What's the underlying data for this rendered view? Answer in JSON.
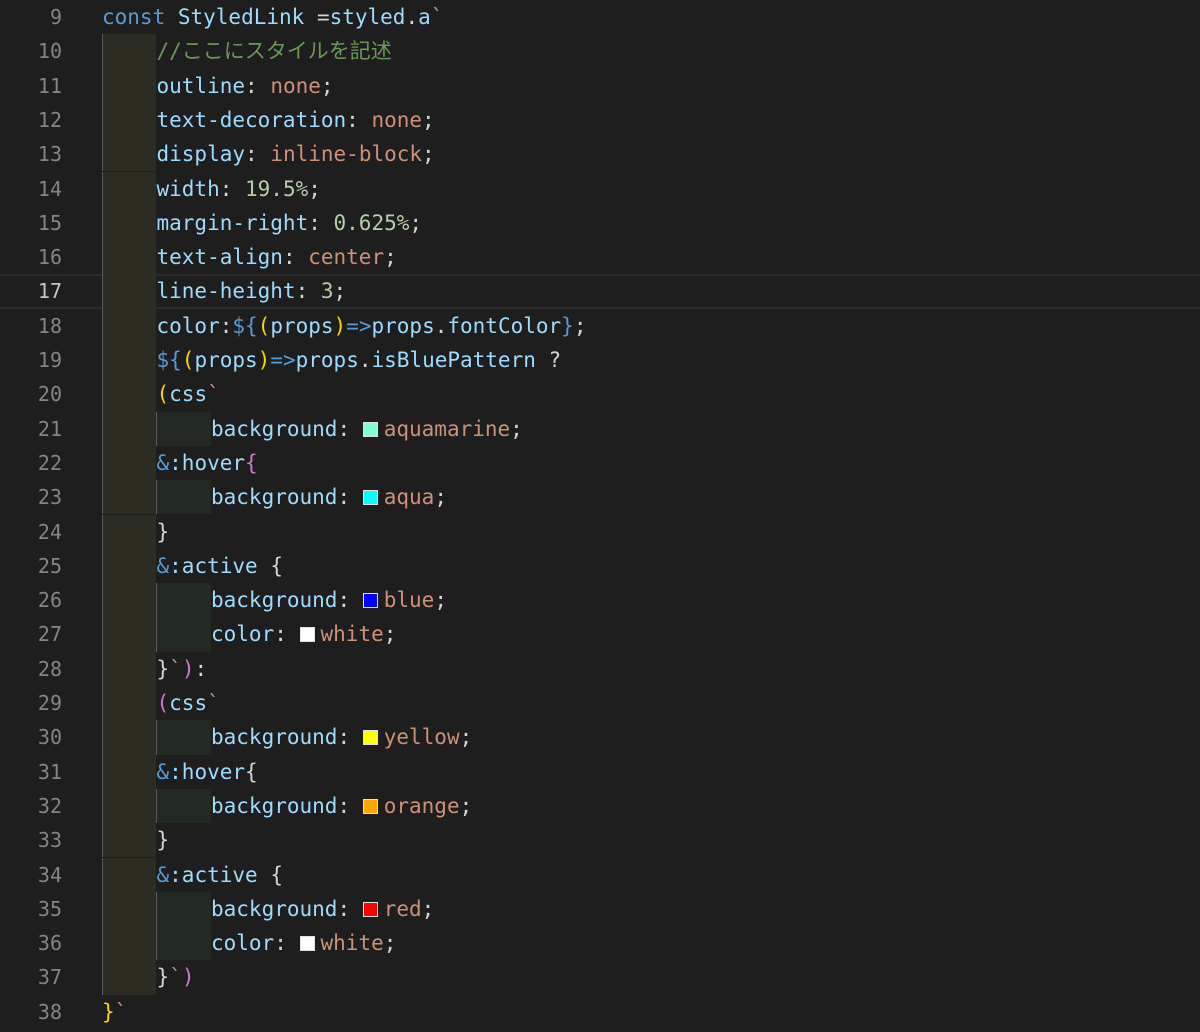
{
  "editor": {
    "current_line": 17,
    "lines": [
      {
        "no": "9",
        "indent": 0,
        "tokens": [
          {
            "t": "const ",
            "c": "keyword"
          },
          {
            "t": "StyledLink",
            "c": "var"
          },
          {
            "t": " =",
            "c": "op"
          },
          {
            "t": "styled",
            "c": "var"
          },
          {
            "t": ".",
            "c": "punct"
          },
          {
            "t": "a",
            "c": "var"
          },
          {
            "t": "`",
            "c": "str"
          }
        ]
      },
      {
        "no": "10",
        "indent": 1,
        "tokens": [
          {
            "t": "//ここにスタイルを記述",
            "c": "comment"
          }
        ]
      },
      {
        "no": "11",
        "indent": 1,
        "tokens": [
          {
            "t": "outline",
            "c": "prop"
          },
          {
            "t": ": ",
            "c": "punct"
          },
          {
            "t": "none",
            "c": "str"
          },
          {
            "t": ";",
            "c": "punct"
          }
        ]
      },
      {
        "no": "12",
        "indent": 1,
        "tokens": [
          {
            "t": "text-decoration",
            "c": "prop"
          },
          {
            "t": ": ",
            "c": "punct"
          },
          {
            "t": "none",
            "c": "str"
          },
          {
            "t": ";",
            "c": "punct"
          }
        ]
      },
      {
        "no": "13",
        "indent": 1,
        "tokens": [
          {
            "t": "display",
            "c": "prop"
          },
          {
            "t": ": ",
            "c": "punct"
          },
          {
            "t": "inline-block",
            "c": "str"
          },
          {
            "t": ";",
            "c": "punct"
          }
        ]
      },
      {
        "no": "14",
        "indent": 1,
        "tokens": [
          {
            "t": "width",
            "c": "prop"
          },
          {
            "t": ": ",
            "c": "punct"
          },
          {
            "t": "19.5%",
            "c": "num"
          },
          {
            "t": ";",
            "c": "punct"
          }
        ]
      },
      {
        "no": "15",
        "indent": 1,
        "tokens": [
          {
            "t": "margin-right",
            "c": "prop"
          },
          {
            "t": ": ",
            "c": "punct"
          },
          {
            "t": "0.625%",
            "c": "num"
          },
          {
            "t": ";",
            "c": "punct"
          }
        ]
      },
      {
        "no": "16",
        "indent": 1,
        "tokens": [
          {
            "t": "text-align",
            "c": "prop"
          },
          {
            "t": ": ",
            "c": "punct"
          },
          {
            "t": "center",
            "c": "str"
          },
          {
            "t": ";",
            "c": "punct"
          }
        ]
      },
      {
        "no": "17",
        "indent": 1,
        "tokens": [
          {
            "t": "line-height",
            "c": "prop"
          },
          {
            "t": ": ",
            "c": "punct"
          },
          {
            "t": "3",
            "c": "num"
          },
          {
            "t": ";",
            "c": "punct"
          }
        ]
      },
      {
        "no": "18",
        "indent": 1,
        "tokens": [
          {
            "t": "color",
            "c": "prop"
          },
          {
            "t": ":",
            "c": "punct"
          },
          {
            "t": "${",
            "c": "template"
          },
          {
            "t": "(",
            "c": "brace1"
          },
          {
            "t": "props",
            "c": "var"
          },
          {
            "t": ")",
            "c": "brace1"
          },
          {
            "t": "=>",
            "c": "keyword"
          },
          {
            "t": "props",
            "c": "var"
          },
          {
            "t": ".",
            "c": "punct"
          },
          {
            "t": "fontColor",
            "c": "var"
          },
          {
            "t": "}",
            "c": "template"
          },
          {
            "t": ";",
            "c": "punct"
          }
        ]
      },
      {
        "no": "19",
        "indent": 1,
        "tokens": [
          {
            "t": "${",
            "c": "template"
          },
          {
            "t": "(",
            "c": "brace1"
          },
          {
            "t": "props",
            "c": "var"
          },
          {
            "t": ")",
            "c": "brace1"
          },
          {
            "t": "=>",
            "c": "keyword"
          },
          {
            "t": "props",
            "c": "var"
          },
          {
            "t": ".",
            "c": "punct"
          },
          {
            "t": "isBluePattern",
            "c": "var"
          },
          {
            "t": " ?",
            "c": "punct"
          }
        ]
      },
      {
        "no": "20",
        "indent": 1,
        "tokens": [
          {
            "t": "(",
            "c": "brace1"
          },
          {
            "t": "css",
            "c": "var"
          },
          {
            "t": "`",
            "c": "str"
          }
        ]
      },
      {
        "no": "21",
        "indent": 2,
        "tokens": [
          {
            "t": "background",
            "c": "prop"
          },
          {
            "t": ": ",
            "c": "punct"
          },
          {
            "swatch": "#7fffd4"
          },
          {
            "t": "aquamarine",
            "c": "str"
          },
          {
            "t": ";",
            "c": "punct"
          }
        ]
      },
      {
        "no": "22",
        "indent": 1,
        "tokens": [
          {
            "t": "&",
            "c": "keyword"
          },
          {
            "t": ":hover",
            "c": "prop"
          },
          {
            "t": "{",
            "c": "brace2"
          }
        ]
      },
      {
        "no": "23",
        "indent": 2,
        "tokens": [
          {
            "t": "background",
            "c": "prop"
          },
          {
            "t": ": ",
            "c": "punct"
          },
          {
            "swatch": "#00ffff"
          },
          {
            "t": "aqua",
            "c": "str"
          },
          {
            "t": ";",
            "c": "punct"
          }
        ]
      },
      {
        "no": "24",
        "indent": 1,
        "tokens": [
          {
            "t": "}",
            "c": "punct"
          }
        ]
      },
      {
        "no": "25",
        "indent": 1,
        "tokens": [
          {
            "t": "&",
            "c": "keyword"
          },
          {
            "t": ":active",
            "c": "prop"
          },
          {
            "t": " {",
            "c": "punct"
          }
        ]
      },
      {
        "no": "26",
        "indent": 2,
        "tokens": [
          {
            "t": "background",
            "c": "prop"
          },
          {
            "t": ": ",
            "c": "punct"
          },
          {
            "swatch": "#0000ff"
          },
          {
            "t": "blue",
            "c": "str"
          },
          {
            "t": ";",
            "c": "punct"
          }
        ]
      },
      {
        "no": "27",
        "indent": 2,
        "tokens": [
          {
            "t": "color",
            "c": "prop"
          },
          {
            "t": ": ",
            "c": "punct"
          },
          {
            "swatch": "#ffffff"
          },
          {
            "t": "white",
            "c": "str"
          },
          {
            "t": ";",
            "c": "punct"
          }
        ]
      },
      {
        "no": "28",
        "indent": 1,
        "tokens": [
          {
            "t": "}",
            "c": "punct"
          },
          {
            "t": "`",
            "c": "str"
          },
          {
            "t": ")",
            "c": "brace2"
          },
          {
            "t": ":",
            "c": "punct"
          }
        ]
      },
      {
        "no": "29",
        "indent": 1,
        "tokens": [
          {
            "t": "(",
            "c": "brace2"
          },
          {
            "t": "css",
            "c": "var"
          },
          {
            "t": "`",
            "c": "str"
          }
        ]
      },
      {
        "no": "30",
        "indent": 2,
        "tokens": [
          {
            "t": "background",
            "c": "prop"
          },
          {
            "t": ": ",
            "c": "punct"
          },
          {
            "swatch": "#ffff00"
          },
          {
            "t": "yellow",
            "c": "str"
          },
          {
            "t": ";",
            "c": "punct"
          }
        ]
      },
      {
        "no": "31",
        "indent": 1,
        "tokens": [
          {
            "t": "&",
            "c": "keyword"
          },
          {
            "t": ":hover",
            "c": "prop"
          },
          {
            "t": "{",
            "c": "punct"
          }
        ]
      },
      {
        "no": "32",
        "indent": 2,
        "tokens": [
          {
            "t": "background",
            "c": "prop"
          },
          {
            "t": ": ",
            "c": "punct"
          },
          {
            "swatch": "#ffa500"
          },
          {
            "t": "orange",
            "c": "str"
          },
          {
            "t": ";",
            "c": "punct"
          }
        ]
      },
      {
        "no": "33",
        "indent": 1,
        "tokens": [
          {
            "t": "}",
            "c": "punct"
          }
        ]
      },
      {
        "no": "34",
        "indent": 1,
        "tokens": [
          {
            "t": "&",
            "c": "keyword"
          },
          {
            "t": ":active",
            "c": "prop"
          },
          {
            "t": " {",
            "c": "punct"
          }
        ]
      },
      {
        "no": "35",
        "indent": 2,
        "tokens": [
          {
            "t": "background",
            "c": "prop"
          },
          {
            "t": ": ",
            "c": "punct"
          },
          {
            "swatch": "#ff0000"
          },
          {
            "t": "red",
            "c": "str"
          },
          {
            "t": ";",
            "c": "punct"
          }
        ]
      },
      {
        "no": "36",
        "indent": 2,
        "tokens": [
          {
            "t": "color",
            "c": "prop"
          },
          {
            "t": ": ",
            "c": "punct"
          },
          {
            "swatch": "#ffffff"
          },
          {
            "t": "white",
            "c": "str"
          },
          {
            "t": ";",
            "c": "punct"
          }
        ]
      },
      {
        "no": "37",
        "indent": 1,
        "tokens": [
          {
            "t": "}",
            "c": "punct"
          },
          {
            "t": "`",
            "c": "str"
          },
          {
            "t": ")",
            "c": "brace2"
          }
        ]
      },
      {
        "no": "38",
        "indent": 0,
        "tokens": [
          {
            "t": "}",
            "c": "brace1"
          },
          {
            "t": "`",
            "c": "str"
          }
        ]
      }
    ]
  }
}
